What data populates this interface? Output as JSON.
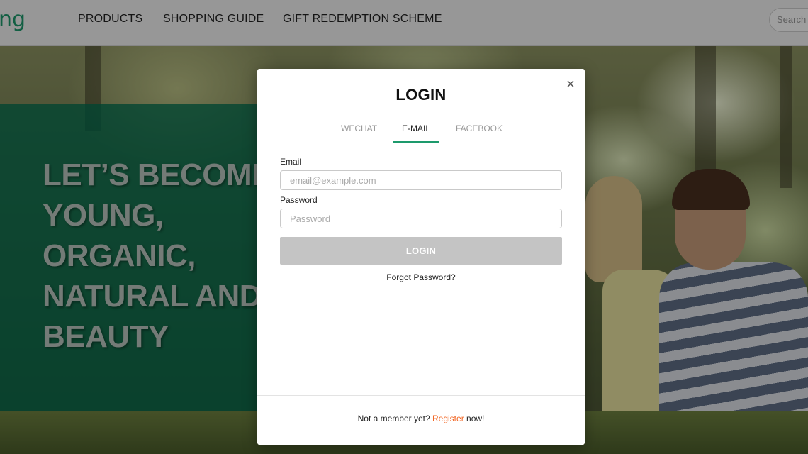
{
  "navbar": {
    "logo_fragment": "ng",
    "items": [
      {
        "label": "PRODUCTS"
      },
      {
        "label": "SHOPPING GUIDE"
      },
      {
        "label": "GIFT REDEMPTION SCHEME"
      }
    ],
    "search_placeholder": "Search"
  },
  "hero": {
    "title": "LET’S BECOME\nYOUNG,\nORGANIC,\nNATURAL AND\nBEAUTY"
  },
  "login_modal": {
    "title": "LOGIN",
    "close_symbol": "×",
    "tabs": [
      {
        "label": "WECHAT",
        "active": false
      },
      {
        "label": "E-MAIL",
        "active": true
      },
      {
        "label": "FACEBOOK",
        "active": false
      }
    ],
    "email": {
      "label": "Email",
      "placeholder": "email@example.com",
      "value": ""
    },
    "password": {
      "label": "Password",
      "placeholder": "Password",
      "value": ""
    },
    "submit_label": "LOGIN",
    "forgot_password": "Forgot Password?",
    "footer": {
      "prefix": "Not a member yet? ",
      "register_link": "Register",
      "suffix": " now!"
    }
  },
  "colors": {
    "brand_green": "#1d9a6c",
    "register_orange": "#f26522",
    "disabled_button": "#c4c4c4"
  }
}
